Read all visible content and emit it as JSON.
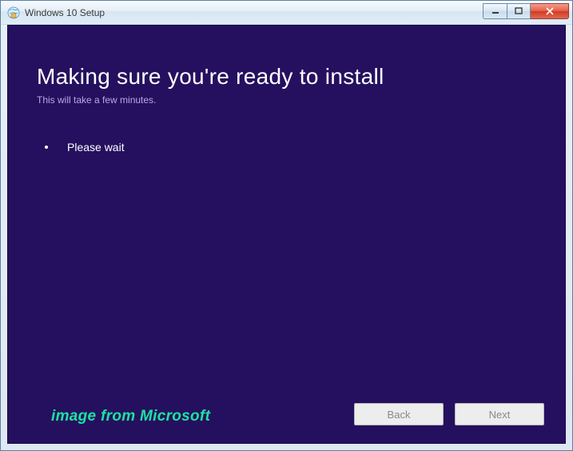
{
  "window": {
    "title": "Windows 10 Setup"
  },
  "main": {
    "heading": "Making sure you're ready to install",
    "subheading": "This will take a few minutes.",
    "wait_text": "Please wait"
  },
  "footer": {
    "back_label": "Back",
    "next_label": "Next"
  },
  "watermark": "image from Microsoft"
}
